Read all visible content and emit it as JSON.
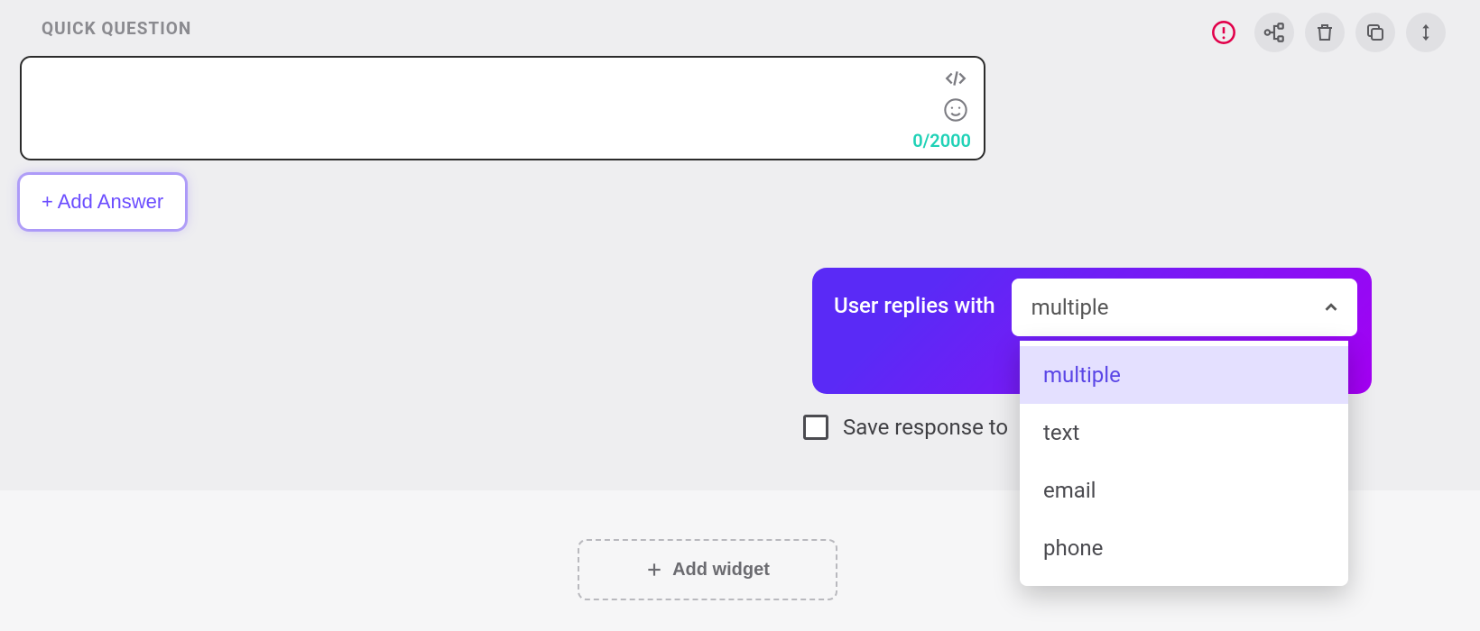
{
  "section_title": "QUICK QUESTION",
  "question": {
    "value": "",
    "counter": "0/2000"
  },
  "add_answer_label": "+ Add Answer",
  "reply": {
    "label": "User replies with",
    "selected": "multiple",
    "options": [
      "multiple",
      "text",
      "email",
      "phone"
    ]
  },
  "save_response_label": "Save response to",
  "add_widget_label": "Add widget",
  "icons": {
    "alert": "alert-circle-icon",
    "flow": "flow-branch-icon",
    "trash": "trash-icon",
    "copy": "copy-icon",
    "drag": "drag-vertical-icon",
    "code": "code-icon",
    "emoji": "emoji-icon",
    "chevron_up": "chevron-up-icon",
    "plus": "plus-icon"
  }
}
